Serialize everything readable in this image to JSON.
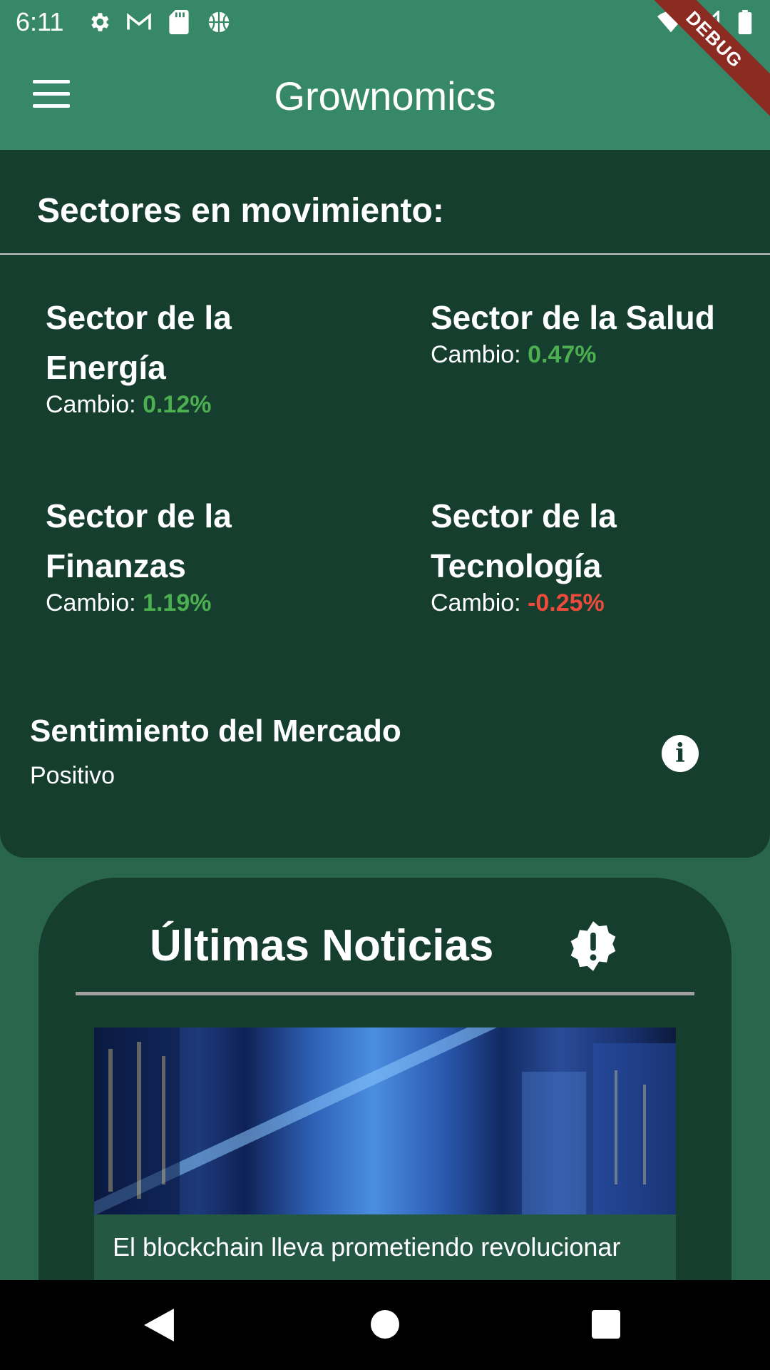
{
  "status_bar": {
    "time": "6:11",
    "left_icons": [
      "settings-icon",
      "gmail-icon",
      "sd-card-icon",
      "basketball-icon"
    ],
    "right_icons": [
      "wifi-icon",
      "signal-icon",
      "battery-icon"
    ]
  },
  "debug_banner": "DEBUG",
  "app_bar": {
    "title": "Grownomics",
    "menu_icon": "menu-icon"
  },
  "sectors_section": {
    "title": "Sectores en movimiento:",
    "change_label": "Cambio:",
    "sectors": [
      {
        "name": "Sector de la Energía",
        "change": "0.12%",
        "trend": "positive"
      },
      {
        "name": "Sector de la Salud",
        "change": "0.47%",
        "trend": "positive"
      },
      {
        "name": "Sector de la Finanzas",
        "change": "1.19%",
        "trend": "positive"
      },
      {
        "name": "Sector de la Tecnología",
        "change": "-0.25%",
        "trend": "negative"
      }
    ],
    "sentiment": {
      "title": "Sentimiento del Mercado",
      "value": "Positivo",
      "icon": "info-icon"
    }
  },
  "news_section": {
    "title": "Últimas Noticias",
    "icon": "alert-badge-icon",
    "items": [
      {
        "text": "El blockchain lleva prometiendo revolucionar"
      }
    ]
  },
  "colors": {
    "app_bar": "#378868",
    "background": "#2a664c",
    "card": "#153e2e",
    "positive": "#4caf50",
    "negative": "#ef4b3c"
  },
  "nav_bar": {
    "buttons": [
      "back-icon",
      "home-icon",
      "recents-icon"
    ]
  }
}
